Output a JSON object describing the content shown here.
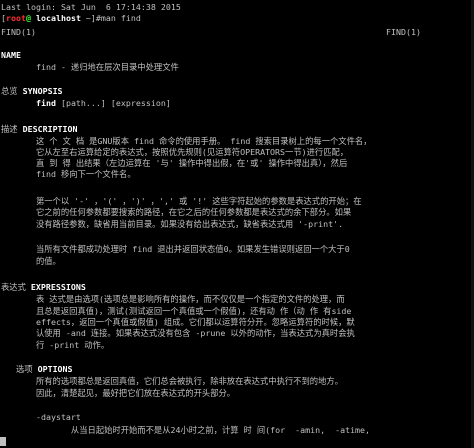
{
  "terminal": {
    "last_login": "Last login: Sat Jun  6 17:14:38 2015",
    "prompt_open": "[",
    "prompt_user": "root",
    "prompt_at": "@",
    "prompt_host": " localhost",
    "prompt_close": " ~]#",
    "command": "man find"
  },
  "man": {
    "header_left": "FIND(1)",
    "header_right": "FIND(1)",
    "name_heading": "NAME",
    "name_text": "       find - 递归地在层次目录中处理文件",
    "synopsis_label": "总览 ",
    "synopsis_heading": "SYNOPSIS",
    "synopsis_cmd": "find",
    "synopsis_args": " [path...] [expression]",
    "description_label": "描述 ",
    "description_heading": "DESCRIPTION",
    "desc_lines": [
      "       这 个 文 档 是GNU版本 find 命令的使用手册。 find 搜索目录树上的每一个文件名，",
      "       它从左至右运算给定的表达式，按照优先规则(见运算符OPERATORS一节)进行匹配，",
      "       直 到 得 出结果（左边运算在 '与' 操作中得出假，在'或' 操作中得出真），然后",
      "       find 移向下一个文件名。",
      "",
      "       第一个以 '-' ，'(' ，')' ，',' 或 '!' 这些字符起始的参数是表达式的开始；在",
      "       它之前的任何参数都要搜索的路径，在它之后的任何参数都是表达式的余下部分。如果",
      "       没有路径参数，缺省用当前目录。如果没有给出表达式，缺省表达式用 '-print'.",
      "",
      "       当所有文件都成功处理时 find 退出并返回状态值0。如果发生错误则返回一个大于0",
      "       的值。"
    ],
    "expressions_label": "表达式 ",
    "expressions_heading": "EXPRESSIONS",
    "expr_lines": [
      "       表 达式是由选项(选项总是影响所有的操作，而不仅仅是一个指定的文件的处理，而",
      "       且总是返回真值)，测试(测试返回一个真值或一个假值)，还有动 作（动 作 有side",
      "       effects，返回一个真值或假值) 组成。它们都以运算符分开。忽略运算符的时候，默",
      "       认使用 -and 连接。如果表达式没有包含 -prune 以外的动作，当表达式为真时会执",
      "       行 -print 动作。"
    ],
    "options_label": "   选项 ",
    "options_heading": "OPTIONS",
    "opt_lines": [
      "       所有的选项都总是返回真值，它们总会被执行，除非放在表达式中执行不到的地方。",
      "       因此，清楚起见，最好把它们放在表达式的开头部分。"
    ],
    "daystart": "       -daystart",
    "daystart_desc": "              从当日起始时开始而不是从24小时之前，计算 时 间(for  -amin,  -atime,"
  }
}
